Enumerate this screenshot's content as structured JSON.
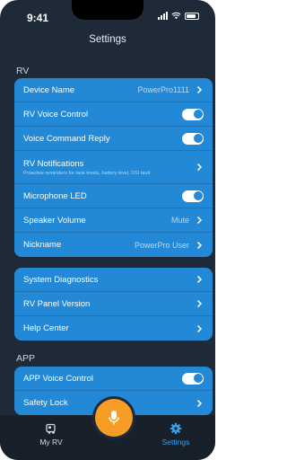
{
  "status": {
    "time": "9:41"
  },
  "header": {
    "title": "Settings"
  },
  "sections": {
    "rv_label": "RV",
    "app_label": "APP"
  },
  "rv_card": {
    "device_name_label": "Device Name",
    "device_name_value": "PowerPro1111",
    "voice_control_label": "RV Voice Control",
    "voice_control_on": true,
    "command_reply_label": "Voice Command Reply",
    "command_reply_on": true,
    "notifications_label": "RV Notifications",
    "notifications_sub": "Proactive reminders for tank levels, battery level, DSI fault",
    "mic_led_label": "Microphone LED",
    "mic_led_on": true,
    "speaker_label": "Speaker Volume",
    "speaker_value": "Mute",
    "nickname_label": "Nickname",
    "nickname_value": "PowerPro User"
  },
  "info_card": {
    "diagnostics_label": "System Diagnostics",
    "panel_version_label": "RV Panel Version",
    "help_label": "Help Center"
  },
  "app_card": {
    "app_voice_label": "APP Voice Control",
    "app_voice_on": true,
    "safety_lock_label": "Safety Lock"
  },
  "tabbar": {
    "my_rv_label": "My RV",
    "settings_label": "Settings",
    "active": "settings"
  },
  "colors": {
    "background": "#1f2a38",
    "card": "#2388d6",
    "accent": "#f59d24",
    "tab_active": "#3aa0ea"
  }
}
